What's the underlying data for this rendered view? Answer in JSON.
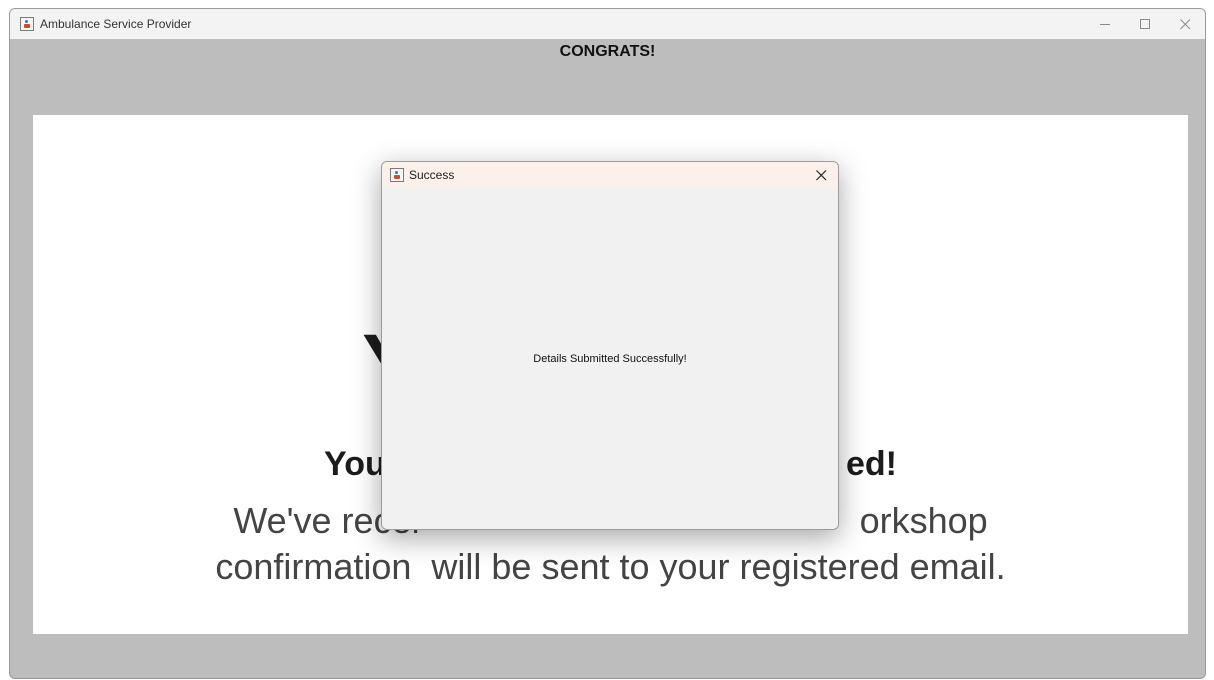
{
  "window": {
    "title": "Ambulance Service Provider",
    "controls": {
      "minimize_icon": "minimize-icon",
      "maximize_icon": "maximize-icon",
      "close_icon": "close-icon"
    }
  },
  "header": {
    "congrats": "CONGRATS!"
  },
  "panel": {
    "big_headline": "Y",
    "sub_headline_left": "You h",
    "sub_headline_right": "ed!",
    "body_line1_left": "We've recei",
    "body_line1_right": "orkshop",
    "body_line2": "confirmation  will be sent to your registered email."
  },
  "dialog": {
    "title": "Success",
    "message": "Details Submitted Successfully!"
  },
  "colors": {
    "window_background": "#bdbdbd",
    "panel_background": "#ffffff",
    "dialog_titlebar": "#fbf1ea",
    "dialog_background": "#f1f1f1"
  }
}
